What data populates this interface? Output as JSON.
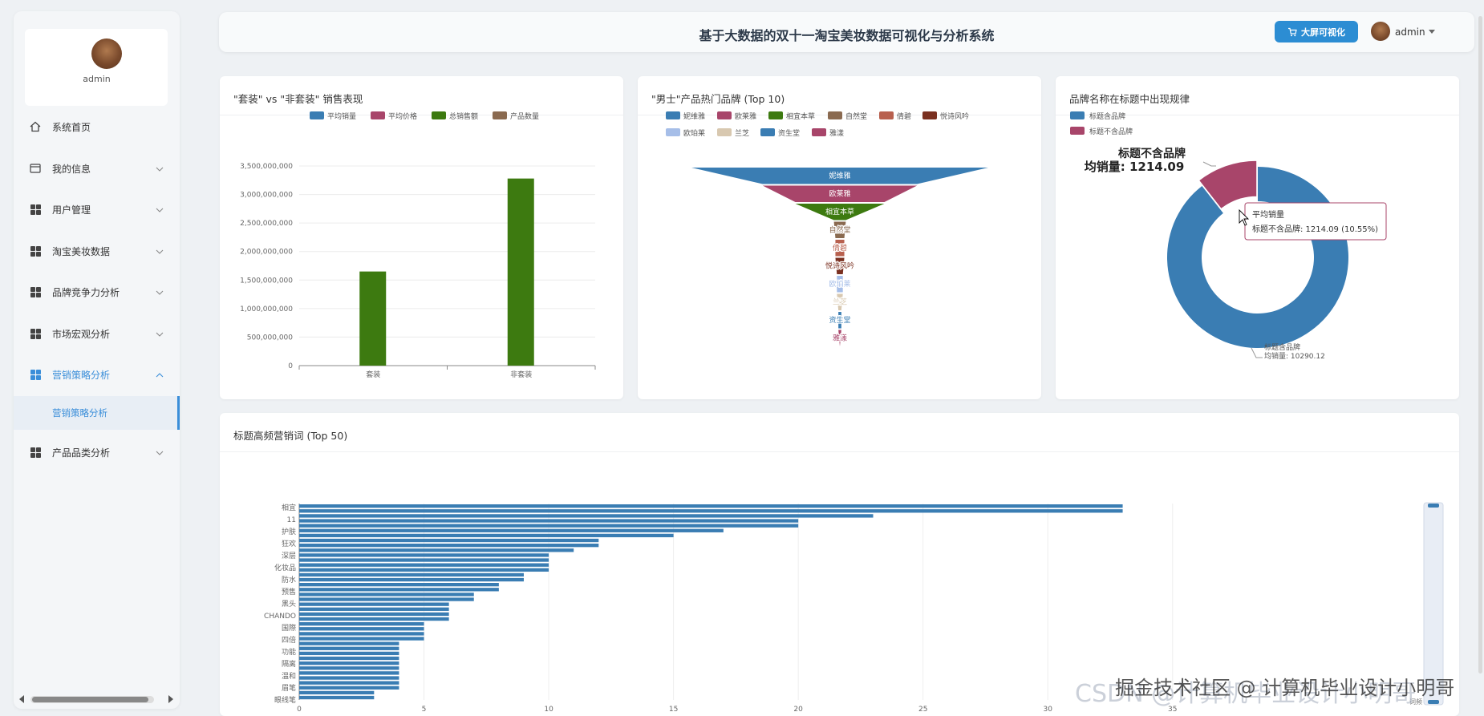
{
  "app": {
    "title": "基于大数据的双十一淘宝美妆数据可视化与分析系统",
    "bigscreen_label": "大屏可视化",
    "username": "admin"
  },
  "sidebar": {
    "username": "admin",
    "items": [
      {
        "label": "系统首页",
        "icon": "home-icon"
      },
      {
        "label": "我的信息",
        "icon": "profile-card-icon"
      },
      {
        "label": "用户管理",
        "icon": "grid-icon"
      },
      {
        "label": "淘宝美妆数据",
        "icon": "grid-icon"
      },
      {
        "label": "品牌竞争力分析",
        "icon": "grid-icon"
      },
      {
        "label": "市场宏观分析",
        "icon": "grid-icon"
      },
      {
        "label": "营销策略分析",
        "icon": "grid-icon"
      },
      {
        "label": "产品品类分析",
        "icon": "grid-icon"
      }
    ],
    "sub_item": "营销策略分析"
  },
  "colors": {
    "blue": "#3a7db3",
    "red": "#a8456a",
    "green": "#3d7a10",
    "brown": "#8a6a50",
    "accent": "#2c8dd3"
  },
  "chart_data": [
    {
      "type": "bar",
      "title": "\"套装\" vs \"非套装\" 销售表现",
      "legend": [
        "平均销量",
        "平均价格",
        "总销售额",
        "产品数量"
      ],
      "legend_colors": [
        "#3a7db3",
        "#a8456a",
        "#3d7a10",
        "#8a6a50"
      ],
      "categories": [
        "套装",
        "非套装"
      ],
      "series": [
        {
          "name": "平均销量",
          "values": [
            0,
            0
          ]
        },
        {
          "name": "平均价格",
          "values": [
            0,
            0
          ]
        },
        {
          "name": "总销售额",
          "values": [
            1650000000,
            3280000000
          ]
        },
        {
          "name": "产品数量",
          "values": [
            0,
            0
          ]
        }
      ],
      "y_ticks": [
        "3,500,000,000",
        "3,000,000,000",
        "2,500,000,000",
        "2,000,000,000",
        "1,500,000,000",
        "1,000,000,000",
        "500,000,000",
        "0"
      ],
      "ylim": [
        0,
        3500000000
      ]
    },
    {
      "type": "funnel",
      "title": "\"男士\"产品热门品牌 (Top 10)",
      "legend": [
        "妮维雅",
        "欧莱雅",
        "相宜本草",
        "自然堂",
        "倩碧",
        "悦诗风吟",
        "欧珀莱",
        "兰芝",
        "资生堂",
        "雅漾"
      ],
      "legend_colors": [
        "#3a7db3",
        "#a8456a",
        "#3d7a10",
        "#8a6a50",
        "#b8604e",
        "#7a3020",
        "#a6bee8",
        "#d8c8b0",
        "#3a7db3",
        "#a8456a"
      ],
      "labels": [
        "妮维雅",
        "欧莱雅",
        "相宜本草",
        "自然堂",
        "倩碧",
        "悦诗风吟",
        "欧珀莱",
        "兰芝",
        "资生堂",
        "雅漾"
      ],
      "values": [
        100,
        52,
        30,
        4,
        3,
        3,
        2,
        2,
        1,
        1
      ]
    },
    {
      "type": "pie",
      "title": "品牌名称在标题中出现规律",
      "legend": [
        "标题含品牌",
        "标题不含品牌"
      ],
      "categories": [
        "标题含品牌",
        "标题不含品牌"
      ],
      "values": [
        10290.12,
        1214.09
      ],
      "colors": [
        "#3a7db3",
        "#a8456a"
      ],
      "emphasis_text": [
        "标题不含品牌",
        "均销量: 1214.09"
      ],
      "outer_label_lines": [
        "标题含品牌",
        "均销量: 10290.12"
      ],
      "tooltip": {
        "title": "平均销量",
        "line": "标题不含品牌: 1214.09 (10.55%)"
      }
    },
    {
      "type": "bar",
      "orientation": "horizontal",
      "title": "标题高频营销词 (Top 50)",
      "x_ticks": [
        "0",
        "5",
        "10",
        "15",
        "20",
        "25",
        "30",
        "35"
      ],
      "xlim": [
        0,
        37
      ],
      "tick_labels": [
        "相宜",
        "11",
        "护肤",
        "狂欢",
        "深层",
        "化妆品",
        "防水",
        "预售",
        "黑头",
        "CHANDO",
        "国際",
        "四倍",
        "功能",
        "隔离",
        "温和",
        "眉笔",
        "眼线笔"
      ],
      "values": [
        33,
        33,
        23,
        20,
        20,
        17,
        15,
        12,
        12,
        11,
        10,
        10,
        10,
        10,
        9,
        9,
        8,
        8,
        7,
        7,
        6,
        6,
        6,
        6,
        5,
        5,
        5,
        5,
        4,
        4,
        4,
        4,
        4,
        4,
        4,
        4,
        4,
        4,
        3,
        3
      ],
      "slider_label": "词频"
    }
  ],
  "watermark": "CSDN @计算机毕业设计小明哥",
  "watermark_overlay": "掘金技术社区 @ 计算机毕业设计小明哥"
}
